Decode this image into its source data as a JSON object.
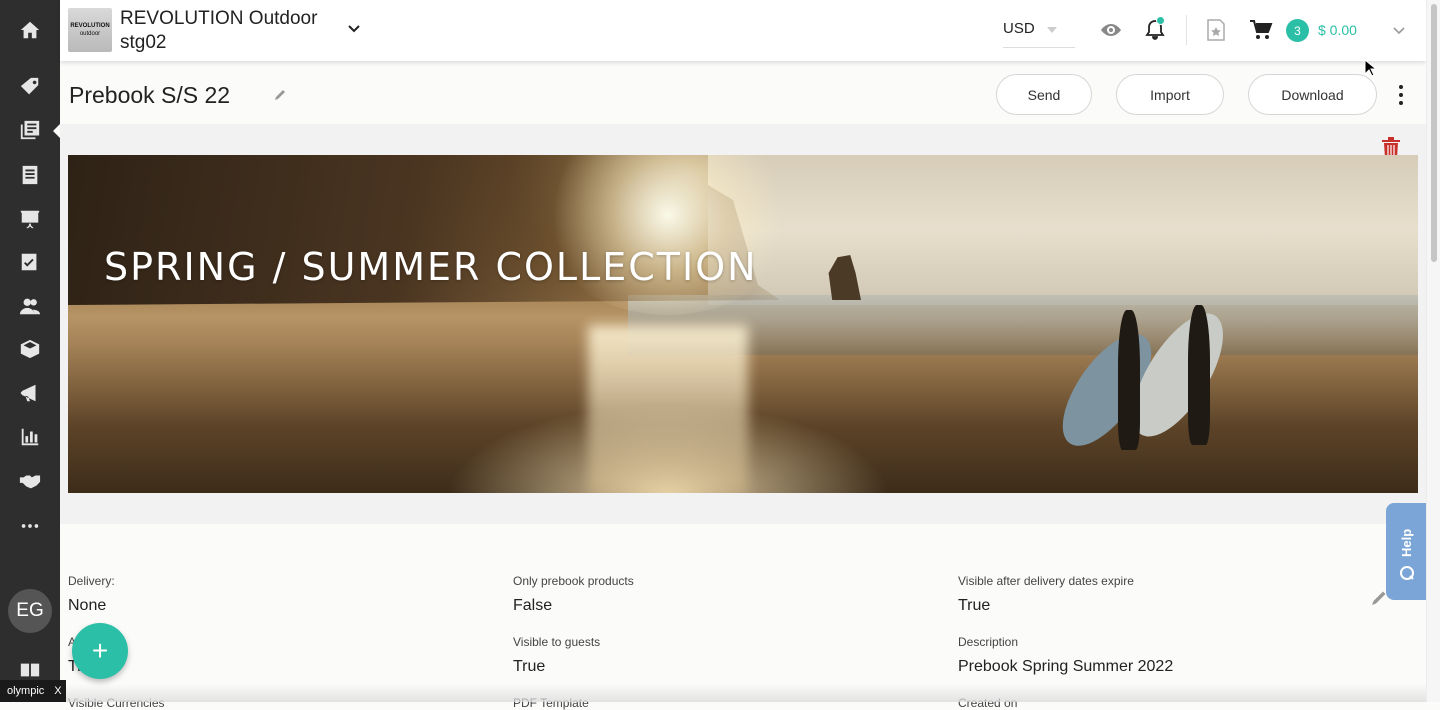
{
  "brand": {
    "line1": "REVOLUTION Outdoor",
    "line2": "stg02",
    "logo_line1": "REVOLUTION",
    "logo_line2": "outdoor"
  },
  "topbar": {
    "currency": "USD",
    "cart_count": "3",
    "cart_total": "$ 0.00"
  },
  "sidebar": {
    "items": [
      "home-icon",
      "tag-icon",
      "catalog-icon",
      "list-icon",
      "presentation-icon",
      "checklist-icon",
      "users-icon",
      "box-icon",
      "promotions-icon",
      "reports-icon",
      "handshake-icon",
      "more-icon",
      "book-icon"
    ],
    "avatar": "EG"
  },
  "page": {
    "title": "Prebook S/S 22",
    "buttons": {
      "send": "Send",
      "import": "Import",
      "download": "Download"
    }
  },
  "banner": {
    "title": "SPRING / SUMMER COLLECTION"
  },
  "details": {
    "delivery_label": "Delivery:",
    "delivery_value": "None",
    "a_label": "A",
    "a_value": "Tr",
    "visible_currencies_label": "Visible Currencies",
    "only_prebook_label": "Only prebook products",
    "only_prebook_value": "False",
    "visible_guests_label": "Visible to guests",
    "visible_guests_value": "True",
    "pdf_template_label": "PDF Template",
    "visible_after_label": "Visible after delivery dates expire",
    "visible_after_value": "True",
    "description_label": "Description",
    "description_value": "Prebook Spring Summer 2022",
    "created_on_label": "Created on"
  },
  "help": {
    "label": "Help"
  },
  "fab": {
    "label": "+"
  },
  "env_chip": {
    "label": "olympic",
    "close": "X"
  },
  "colors": {
    "accent": "#2abfa6",
    "sidebar": "#2e2e2e",
    "help": "#7aa5d6",
    "trash": "#c8302a"
  }
}
